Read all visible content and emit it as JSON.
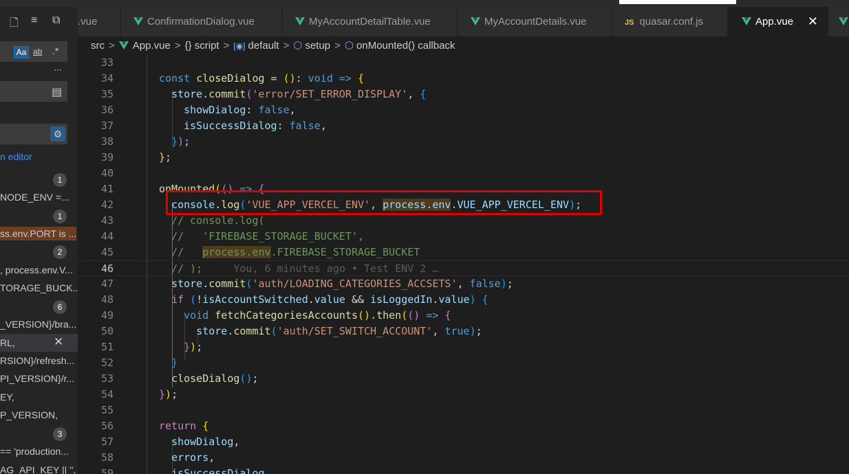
{
  "left_panel": {
    "case_toggle": "Aa",
    "word_toggle": "ab",
    "regex_toggle": ".*",
    "more": "...",
    "editor_link": "n editor",
    "results": [
      {
        "badge": "1",
        "text": "NODE_ENV =..."
      },
      {
        "badge": "1",
        "text": "ss.env.PORT is ..."
      },
      {
        "badge": "2",
        "text": ", process.env.V..."
      },
      {
        "text": "TORAGE_BUCK..."
      },
      {
        "badge": "6",
        "text": "_VERSION}/bra..."
      },
      {
        "text": "RL,"
      },
      {
        "text": "RSION}/refresh..."
      },
      {
        "text": "PI_VERSION}/r..."
      },
      {
        "text": "EY,"
      },
      {
        "text": "P_VERSION,"
      },
      {
        "badge": "3",
        "text": "== 'production..."
      },
      {
        "text": "AG_API_KEY || '',"
      }
    ]
  },
  "tabs": [
    {
      "label": ".vue",
      "icon": "vue-icon"
    },
    {
      "label": "ConfirmationDialog.vue",
      "icon": "vue-icon"
    },
    {
      "label": "MyAccountDetailTable.vue",
      "icon": "vue-icon"
    },
    {
      "label": "MyAccountDetails.vue",
      "icon": "vue-icon"
    },
    {
      "label": "quasar.conf.js",
      "icon": "js-icon",
      "icon_text": "JS"
    },
    {
      "label": "App.vue",
      "icon": "vue-icon",
      "active": true
    }
  ],
  "breadcrumb": {
    "items": [
      "src",
      "App.vue",
      "{} script",
      "default",
      "setup",
      "onMounted() callback"
    ],
    "separator": ">"
  },
  "editor": {
    "lines": [
      {
        "n": "33",
        "html": ""
      },
      {
        "n": "34",
        "html": "<span class=\"kw\">const</span> <span class=\"fn\">closeDialog</span> = <span class=\"br1\">()</span>: <span class=\"kw\">void</span> <span class=\"kw\">=&gt;</span> <span class=\"br1\">{</span>"
      },
      {
        "n": "35",
        "html": "  <span class=\"var\">store</span>.<span class=\"fn\">commit</span><span class=\"br2\">(</span><span class=\"str\">'error/SET_ERROR_DISPLAY'</span>, <span class=\"br3\">{</span>"
      },
      {
        "n": "36",
        "html": "    <span class=\"var\">showDialog</span>: <span class=\"kw\">false</span>,"
      },
      {
        "n": "37",
        "html": "    <span class=\"var\">isSuccessDialog</span>: <span class=\"kw\">false</span>,"
      },
      {
        "n": "38",
        "html": "  <span class=\"br3\">}</span><span class=\"br2\">)</span>;"
      },
      {
        "n": "39",
        "html": "<span class=\"br1\">}</span>;"
      },
      {
        "n": "40",
        "html": ""
      },
      {
        "n": "41",
        "html": "<span class=\"fn\">onMounted</span><span class=\"br1\">(</span><span class=\"br2\">()</span> <span class=\"kw\">=&gt;</span> <span class=\"br2\">{</span>"
      },
      {
        "n": "42",
        "html": "  <span class=\"var\">console</span>.<span class=\"fn\">log</span><span class=\"br3\">(</span><span class=\"str\">'VUE_APP_VERCEL_ENV'</span>, <span class=\"pe\"><span class=\"var\">process</span>.<span class=\"var\">env</span></span>.<span class=\"var\">VUE_APP_VERCEL_ENV</span><span class=\"br3\">)</span>;"
      },
      {
        "n": "43",
        "html": "  <span class=\"com\">// console.log(</span>"
      },
      {
        "n": "44",
        "html": "  <span class=\"com\">//   'FIREBASE_STORAGE_BUCKET',</span>"
      },
      {
        "n": "45",
        "html": "  <span class=\"com\">//   </span><span class=\"com pe\">process.env</span><span class=\"com\">.FIREBASE_STORAGE_BUCKET</span>"
      },
      {
        "n": "46",
        "html": "  <span class=\"com\">// );</span>     <span class=\"blame\">You, 6 minutes ago • Test ENV 2 …</span>",
        "current": true
      },
      {
        "n": "47",
        "html": "  <span class=\"var\">store</span>.<span class=\"fn\">commit</span><span class=\"br3\">(</span><span class=\"str\">'auth/LOADING_CATEGORIES_ACCSETS'</span>, <span class=\"kw\">false</span><span class=\"br3\">)</span>;"
      },
      {
        "n": "48",
        "html": "  <span class=\"ctl\">if</span> <span class=\"br3\">(</span>!<span class=\"var\">isAccountSwitched</span>.<span class=\"var\">value</span> &amp;&amp; <span class=\"var\">isLoggedIn</span>.<span class=\"var\">value</span><span class=\"br3\">)</span> <span class=\"br3\">{</span>"
      },
      {
        "n": "49",
        "html": "    <span class=\"kw\">void</span> <span class=\"fn\">fetchCategoriesAccounts</span><span class=\"br1\">()</span>.<span class=\"fn\">then</span><span class=\"br1\">(</span><span class=\"br2\">()</span> <span class=\"kw\">=&gt;</span> <span class=\"br2\">{</span>"
      },
      {
        "n": "50",
        "html": "      <span class=\"var\">store</span>.<span class=\"fn\">commit</span><span class=\"br3\">(</span><span class=\"str\">'auth/SET_SWITCH_ACCOUNT'</span>, <span class=\"kw\">true</span><span class=\"br3\">)</span>;"
      },
      {
        "n": "51",
        "html": "    <span class=\"br2\">}</span><span class=\"br1\">)</span>;"
      },
      {
        "n": "52",
        "html": "  <span class=\"br3\">}</span>"
      },
      {
        "n": "53",
        "html": "  <span class=\"fn\">closeDialog</span><span class=\"br3\">()</span>;"
      },
      {
        "n": "54",
        "html": "<span class=\"br2\">}</span><span class=\"br1\">)</span>;"
      },
      {
        "n": "55",
        "html": ""
      },
      {
        "n": "56",
        "html": "<span class=\"ctl\">return</span> <span class=\"br1\">{</span>"
      },
      {
        "n": "57",
        "html": "  <span class=\"var\">showDialog</span>,"
      },
      {
        "n": "58",
        "html": "  <span class=\"var\">errors</span>,"
      },
      {
        "n": "59",
        "html": "  <span class=\"var\">isSuccessDialog</span>,"
      }
    ]
  }
}
